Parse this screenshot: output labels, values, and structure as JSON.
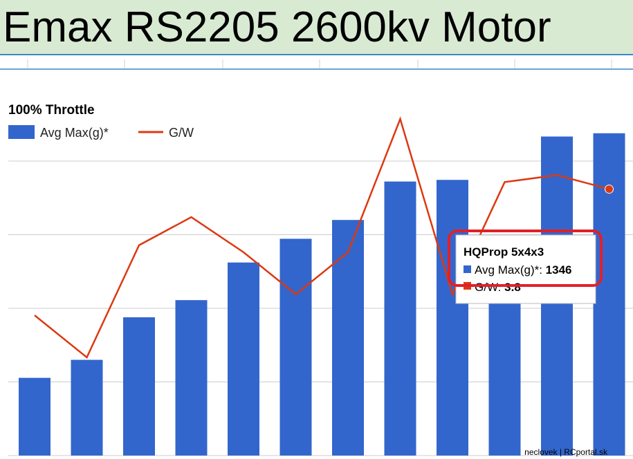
{
  "page": {
    "title": "Emax RS2205 2600kv Motor"
  },
  "colors": {
    "header_bg": "#d9ead3",
    "accent_line": "#3d85c6",
    "bar": "#3366cc",
    "line": "#dc3912",
    "highlight": "#e0202a",
    "grid": "#cccccc"
  },
  "chart_data": {
    "type": "bar",
    "title": "100% Throttle",
    "legend_position": "top-left",
    "grid": true,
    "ylim": [
      0,
      1800
    ],
    "y2lim": [
      0,
      4.2
    ],
    "categories": [
      "",
      "",
      "",
      "",
      "",
      "",
      "",
      "",
      "",
      "",
      "",
      ""
    ],
    "series": [
      {
        "name": "Avg Max(g)*",
        "kind": "bar",
        "color": "#3366cc",
        "values": [
          475,
          585,
          845,
          950,
          1180,
          1325,
          1440,
          1675,
          1685,
          1295,
          1950,
          1970
        ]
      },
      {
        "name": "G/W",
        "kind": "line",
        "axis": "secondary",
        "color": "#dc3912",
        "values": [
          2.0,
          1.4,
          3.0,
          3.4,
          2.9,
          2.3,
          2.9,
          4.8,
          2.3,
          3.9,
          4.0,
          3.8
        ]
      }
    ],
    "tooltip": {
      "title": "HQProp 5x4x3",
      "items": [
        {
          "label": "Avg Max(g)*",
          "value": "1346",
          "color": "#3366cc"
        },
        {
          "label": "G/W",
          "value": "3.8",
          "color": "#dc3912"
        }
      ]
    },
    "selected_point_index": 11
  },
  "watermark": "neclovek | RCportal.sk"
}
